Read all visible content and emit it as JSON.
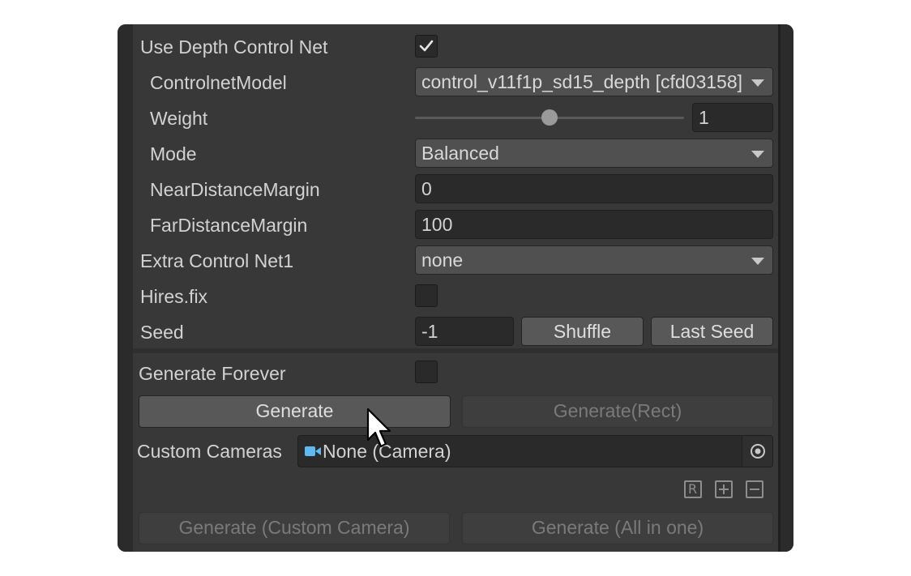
{
  "rows": {
    "use_depth": {
      "label": "Use Depth Control Net",
      "checked": true
    },
    "controlnet_model": {
      "label": "ControlnetModel",
      "value": "control_v11f1p_sd15_depth [cfd03158]"
    },
    "weight": {
      "label": "Weight",
      "value": "1",
      "slider_fraction": 0.5
    },
    "mode": {
      "label": "Mode",
      "value": "Balanced"
    },
    "near_margin": {
      "label": "NearDistanceMargin",
      "value": "0"
    },
    "far_margin": {
      "label": "FarDistanceMargin",
      "value": "100"
    },
    "extra_cn1": {
      "label": "Extra Control Net1",
      "value": "none"
    },
    "hires": {
      "label": "Hires.fix",
      "checked": false
    },
    "seed": {
      "label": "Seed",
      "value": "-1",
      "shuffle": "Shuffle",
      "last_seed": "Last Seed"
    }
  },
  "generate_forever": {
    "label": "Generate Forever",
    "checked": false
  },
  "buttons": {
    "generate": "Generate",
    "generate_rect": "Generate(Rect)",
    "generate_custom_camera": "Generate (Custom Camera)",
    "generate_all": "Generate (All in one)"
  },
  "custom_cameras": {
    "label": "Custom Cameras",
    "value": "None (Camera)"
  },
  "list_controls": {
    "reorder": "R"
  },
  "icons": {
    "checkmark": "check-icon",
    "camera": "camera-icon",
    "picker": "object-picker-icon",
    "cursor": "mouse-cursor-icon"
  },
  "colors": {
    "camera_icon": "#5fb8f0"
  }
}
